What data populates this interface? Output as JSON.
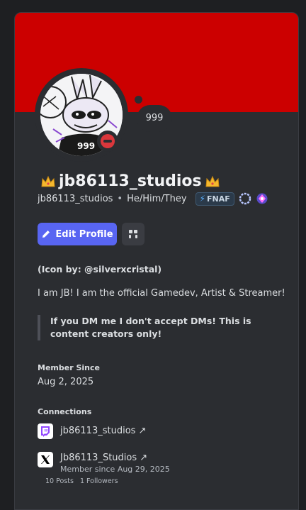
{
  "profile": {
    "display_name": "jb86113_studios",
    "username": "jb86113_studios",
    "separator": "•",
    "pronouns": "He/Him/They",
    "game_badge": "FNAF",
    "bubble_count": "999",
    "avatar_jersey": "999"
  },
  "actions": {
    "edit_label": "Edit Profile"
  },
  "about": {
    "credit": "(Icon by: @silverxcristal)",
    "bio": "I am JB! I am the official Gamedev, Artist & Streamer!",
    "quote_line1": "If you DM me I don't accept DMs! This is",
    "quote_line2": "content creators only!"
  },
  "member_since": {
    "label": "Member Since",
    "value": "Aug 2, 2025"
  },
  "connections": {
    "label": "Connections",
    "twitch": {
      "name": "jb86113_studios ↗",
      "icon": "twitch-icon"
    },
    "x": {
      "name": "Jb86113_Studios ↗",
      "sub": "Member since Aug 29, 2025",
      "posts": "10 Posts",
      "followers": "1 Followers",
      "icon": "x-icon"
    }
  },
  "colors": {
    "banner": "#cc0000",
    "accent": "#5865f2",
    "status_dnd": "#da373c",
    "twitch": "#9146ff"
  }
}
